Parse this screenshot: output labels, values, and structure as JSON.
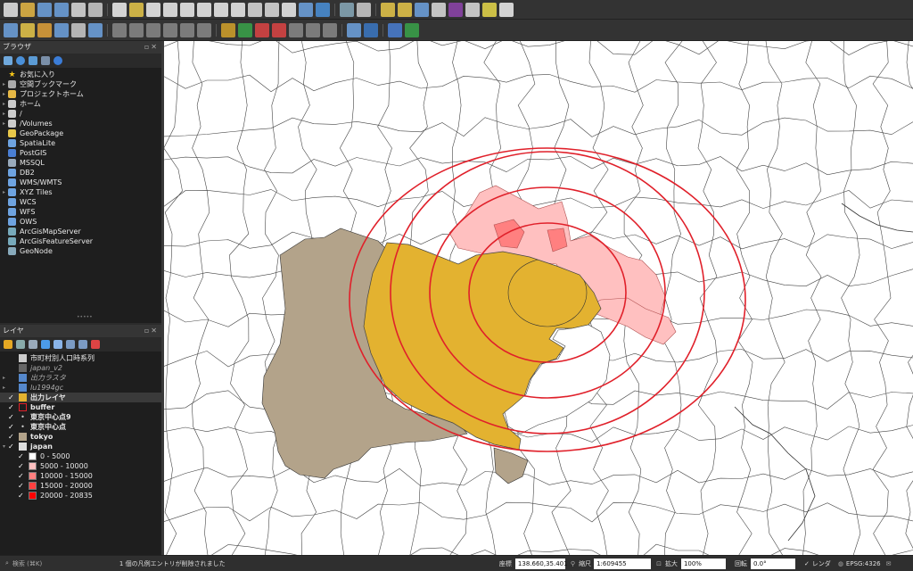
{
  "browser_panel": {
    "title": "ブラウザ",
    "items": [
      {
        "label": "お気に入り",
        "icon": "star-icon",
        "expand": false
      },
      {
        "label": "空間ブックマーク",
        "icon": "bookmark-icon",
        "expand": true
      },
      {
        "label": "プロジェクトホーム",
        "icon": "project-home-icon",
        "expand": true
      },
      {
        "label": "ホーム",
        "icon": "home-folder-icon",
        "expand": true
      },
      {
        "label": "/",
        "icon": "folder-icon",
        "expand": true
      },
      {
        "label": "/Volumes",
        "icon": "folder-icon",
        "expand": true
      },
      {
        "label": "GeoPackage",
        "icon": "geopackage-icon",
        "expand": false
      },
      {
        "label": "SpatiaLite",
        "icon": "spatialite-icon",
        "expand": false
      },
      {
        "label": "PostGIS",
        "icon": "postgis-icon",
        "expand": false
      },
      {
        "label": "MSSQL",
        "icon": "mssql-icon",
        "expand": false
      },
      {
        "label": "DB2",
        "icon": "db2-icon",
        "expand": false
      },
      {
        "label": "WMS/WMTS",
        "icon": "wms-icon",
        "expand": false
      },
      {
        "label": "XYZ Tiles",
        "icon": "xyz-tiles-icon",
        "expand": true
      },
      {
        "label": "WCS",
        "icon": "wcs-icon",
        "expand": false
      },
      {
        "label": "WFS",
        "icon": "wfs-icon",
        "expand": false
      },
      {
        "label": "OWS",
        "icon": "ows-icon",
        "expand": false
      },
      {
        "label": "ArcGisMapServer",
        "icon": "arcgis-map-icon",
        "expand": false
      },
      {
        "label": "ArcGisFeatureServer",
        "icon": "arcgis-feature-icon",
        "expand": false
      },
      {
        "label": "GeoNode",
        "icon": "geonode-icon",
        "expand": false
      }
    ]
  },
  "layers_panel": {
    "title": "レイヤ",
    "layers": [
      {
        "label": "市町村別人口時系列",
        "checked": false,
        "style": "normal"
      },
      {
        "label": "japan_v2",
        "checked": false,
        "style": "dim"
      },
      {
        "label": "出力ラスタ",
        "checked": false,
        "style": "dim"
      },
      {
        "label": "lu1994gc",
        "checked": false,
        "style": "dim"
      },
      {
        "label": "出力レイヤ",
        "checked": true,
        "style": "bold"
      },
      {
        "label": "buffer",
        "checked": true,
        "style": "bold"
      },
      {
        "label": "東京中心点9",
        "checked": true,
        "style": "bold"
      },
      {
        "label": "東京中心点",
        "checked": true,
        "style": "bold"
      },
      {
        "label": "tokyo",
        "checked": true,
        "style": "bold"
      },
      {
        "label": "japan",
        "checked": true,
        "style": "bold"
      }
    ],
    "legend": [
      {
        "label": "0 - 5000",
        "color": "#ffffff"
      },
      {
        "label": "5000 - 10000",
        "color": "#ffc0c0"
      },
      {
        "label": "10000 - 15000",
        "color": "#ff8080"
      },
      {
        "label": "15000 - 20000",
        "color": "#ff4040"
      },
      {
        "label": "20000 - 20835",
        "color": "#ff0000"
      }
    ]
  },
  "status_bar": {
    "search_placeholder": "検索 (⌘K)",
    "message": "1 個の凡例エントリが削除されました",
    "coord_label": "座標",
    "coord_value": "138.660,35.401",
    "scale_label": "縮尺",
    "scale_value": "1:609455",
    "magnifier_label": "拡大",
    "magnifier_value": "100%",
    "rotation_label": "回転",
    "rotation_value": "0.0°",
    "render_label": "レンダ",
    "crs_value": "EPSG:4326"
  },
  "colors": {
    "output_layer": "#e3b230",
    "tokyo": "#b3a38a",
    "buffer_ring": "#e0202a",
    "pink_low": "#ffc0c0",
    "pink_mid": "#ff8080"
  }
}
